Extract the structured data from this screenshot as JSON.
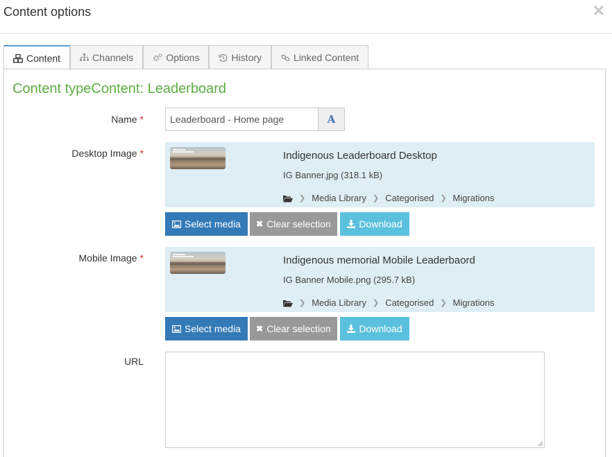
{
  "dialog": {
    "title": "Content options",
    "close_glyph": "✕"
  },
  "tabs": [
    {
      "label": "Content",
      "icon": "cubes-icon",
      "active": true
    },
    {
      "label": "Channels",
      "icon": "sitemap-icon",
      "active": false
    },
    {
      "label": "Options",
      "icon": "cogs-icon",
      "active": false
    },
    {
      "label": "History",
      "icon": "history-icon",
      "active": false
    },
    {
      "label": "Linked Content",
      "icon": "link-icon",
      "active": false
    }
  ],
  "content_type": "Content typeContent: Leaderboard",
  "fields": {
    "name": {
      "label": "Name",
      "required": "*",
      "value": "Leaderboard - Home page",
      "button_glyph": "A"
    },
    "desktop_image": {
      "label": "Desktop Image",
      "required": "*",
      "title": "Indigenous Leaderboard Desktop",
      "file": "IG Banner.jpg (318.1 kB)",
      "path": [
        "Media Library",
        "Categorised",
        "Migrations"
      ]
    },
    "mobile_image": {
      "label": "Mobile Image",
      "required": "*",
      "title": "Indigenous memorial Mobile Leaderbaord",
      "file": "IG Banner Mobile.png (295.7 kB)",
      "path": [
        "Media Library",
        "Categorised",
        "Migrations"
      ]
    },
    "url": {
      "label": "URL",
      "value": ""
    }
  },
  "buttons": {
    "select": "Select media",
    "clear": "Clear selection",
    "download": "Download"
  },
  "colors": {
    "primary": "#337ab7",
    "muted": "#999999",
    "info": "#5bc0de",
    "heading_green": "#5cae42",
    "media_bg": "#dfeef4",
    "required": "#cc3333"
  }
}
